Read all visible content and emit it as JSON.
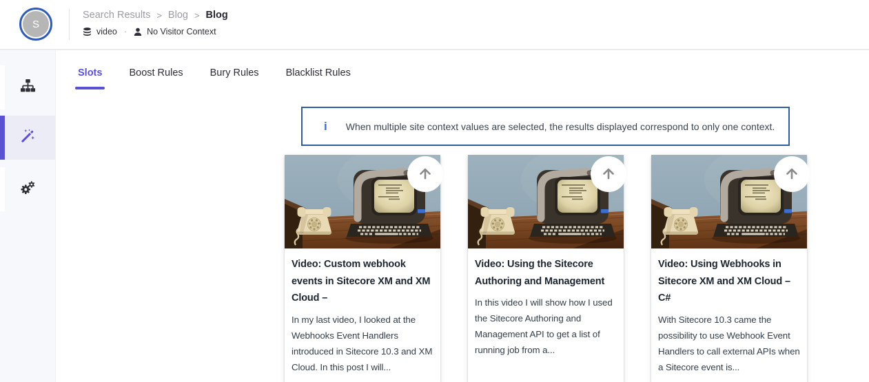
{
  "header": {
    "avatar_initial": "S",
    "breadcrumb": [
      "Search Results",
      "Blog",
      "Blog"
    ],
    "separator": ">",
    "context": {
      "source": "video",
      "dot": "·",
      "visitor": "No Visitor Context"
    }
  },
  "sidebar": {
    "items": [
      {
        "icon": "sitemap-icon",
        "active": false
      },
      {
        "icon": "magic-wand-icon",
        "active": true
      },
      {
        "icon": "gears-icon",
        "active": false
      }
    ]
  },
  "tabs": [
    {
      "label": "Slots",
      "active": true
    },
    {
      "label": "Boost Rules",
      "active": false
    },
    {
      "label": "Bury Rules",
      "active": false
    },
    {
      "label": "Blacklist Rules",
      "active": false
    }
  ],
  "banner": {
    "icon": "info-icon",
    "glyph": "i",
    "text": "When multiple site context values are selected, the results displayed correspond to only one context."
  },
  "cards": [
    {
      "title": "Video: Custom webhook events in Sitecore XM and XM Cloud –",
      "description": "In my last video, I looked at the Webhooks Event Handlers introduced in Sitecore 10.3 and XM Cloud. In this post I will..."
    },
    {
      "title": "Video: Using the Sitecore Authoring and Management",
      "description": "In this video I will show how I used the Sitecore Authoring and Management API to get a list of running job from a..."
    },
    {
      "title": "Video: Using Webhooks in Sitecore XM and XM Cloud – C#",
      "description": "With Sitecore 10.3 came the possibility to use Webhook Event Handlers to call external APIs when a Sitecore event is..."
    }
  ],
  "colors": {
    "accent": "#5A50D8",
    "banner_border": "#2E5C9E",
    "info_blue": "#3E6AC8",
    "avatar_ring": "#2F5CB8"
  }
}
